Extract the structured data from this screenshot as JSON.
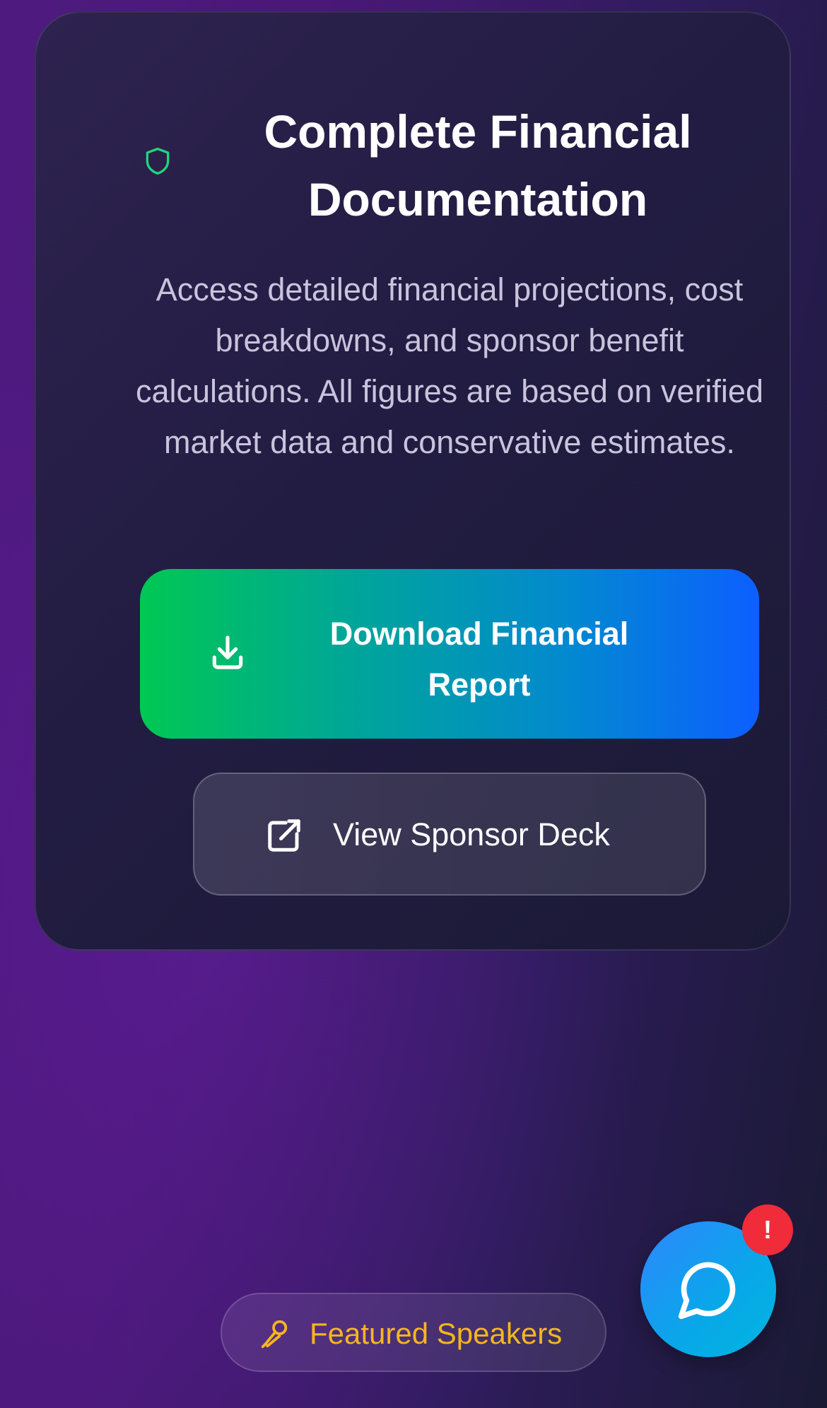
{
  "card": {
    "title": "Complete Financial Documentation",
    "description": "Access detailed financial projections, cost breakdowns, and sponsor benefit calculations. All figures are based on verified market data and conservative estimates.",
    "shield_icon": "shield-icon",
    "primary_button": {
      "label": "Download Financial Report",
      "icon": "download-icon"
    },
    "secondary_button": {
      "label": "View Sponsor Deck",
      "icon": "external-link-icon"
    }
  },
  "featured": {
    "label": "Featured Speakers",
    "icon": "microphone-icon"
  },
  "chat": {
    "icon": "chat-bubble-icon",
    "badge": "!"
  },
  "colors": {
    "accent_green": "#00c853",
    "accent_blue": "#0d5fff",
    "featured_text": "#f7b51e",
    "badge_red": "#f02b3a",
    "shield_green": "#1fd67a"
  }
}
